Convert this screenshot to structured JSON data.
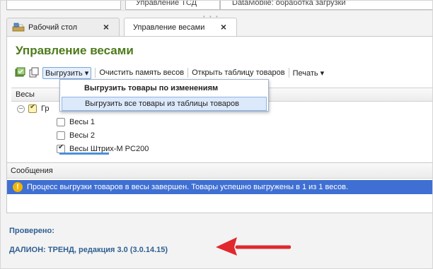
{
  "top_bar": {
    "fields": [
      "",
      "Управление ТСД",
      "DataMobile: обработка загрузки"
    ]
  },
  "tabs": [
    {
      "label": "Рабочий стол",
      "close": "×"
    },
    {
      "label": "Управление весами",
      "close": "×"
    }
  ],
  "page_title": "Управление весами",
  "toolbar": {
    "unload_label": "Выгрузить",
    "clear_label": "Очистить память весов",
    "open_table_label": "Открыть таблицу товаров",
    "print_label": "Печать"
  },
  "dropdown": {
    "item_changes": "Выгрузить товары по изменениям",
    "item_all": "Выгрузить все товары из таблицы товаров"
  },
  "grid": {
    "column_header": "Весы",
    "group_label": "Гр",
    "rows": [
      {
        "label": "Весы 1",
        "checked": false
      },
      {
        "label": "Весы 2",
        "checked": false
      },
      {
        "label": "Весы Штрих-М PC200",
        "checked": true
      }
    ]
  },
  "messages": {
    "title": "Сообщения",
    "line": "Процесс выгрузки товаров в весы завершен. Товары успешно выгружены в 1 из 1 весов."
  },
  "footer": {
    "checked_label": "Проверено:",
    "release": "ДАЛИОН: ТРЕНД, редакция 3.0 (3.0.14.15)"
  },
  "colors": {
    "title_green": "#4d7a1b",
    "link_blue": "#2f5f92",
    "message_highlight": "#3f6fd2",
    "arrow_red": "#e0282d"
  }
}
